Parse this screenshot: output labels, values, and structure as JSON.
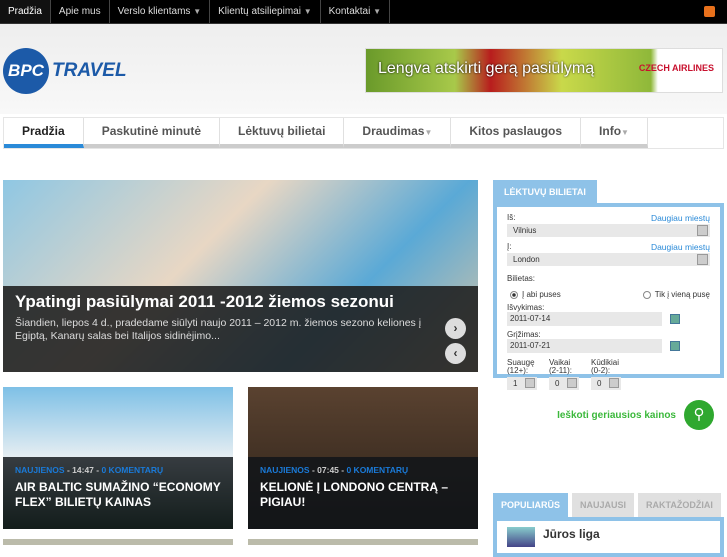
{
  "topnav": [
    {
      "label": "Pradžia",
      "active": true
    },
    {
      "label": "Apie mus"
    },
    {
      "label": "Verslo klientams",
      "dropdown": true
    },
    {
      "label": "Klientų atsiliepimai",
      "dropdown": true
    },
    {
      "label": "Kontaktai",
      "dropdown": true
    }
  ],
  "logo": {
    "circle": "BPC",
    "text": "TRAVEL"
  },
  "banner": {
    "text": "Lengva atskirti gerą pasiūlymą",
    "brand": "CZECH AIRLINES"
  },
  "mainnav": [
    {
      "label": "Pradžia",
      "active": true
    },
    {
      "label": "Paskutinė minutė"
    },
    {
      "label": "Lėktuvų bilietai"
    },
    {
      "label": "Draudimas",
      "dropdown": true
    },
    {
      "label": "Kitos paslaugos"
    },
    {
      "label": "Info",
      "dropdown": true
    }
  ],
  "slider": {
    "title": "Ypatingi pasiūlymai 2011 -2012 žiemos sezonui",
    "text": "Šiandien, liepos 4 d., pradedame siūlyti naujo 2011 – 2012 m.  žiemos sezono keliones į Egiptą, Kanarų salas bei Italijos sidinėjimo...",
    "next": "›",
    "prev": "‹"
  },
  "cards": [
    {
      "category": "NAUJIENOS",
      "time": "14:47",
      "comments": "0 KOMENTARŲ",
      "title": "AIR BALTIC SUMAŽINO “ECONOMY FLEX” BILIETŲ KAINAS"
    },
    {
      "category": "NAUJIENOS",
      "time": "07:45",
      "comments": "0 KOMENTARŲ",
      "title": "KELIONĖ Į LONDONO CENTRĄ – PIGIAU!"
    }
  ],
  "booking": {
    "tab": "LĖKTUVŲ BILIETAI",
    "from_label": "Iš:",
    "from_value": "Vilnius",
    "to_label": "Į:",
    "to_value": "London",
    "more_cities": "Daugiau miestų",
    "ticket_label": "Bilietas:",
    "round": "Į abi puses",
    "oneway": "Tik į vieną pusę",
    "depart_label": "Išvykimas:",
    "depart": "2011-07-14",
    "return_label": "Grįžimas:",
    "return": "2011-07-21",
    "adults_label": "Suaugę (12+):",
    "adults": "1",
    "children_label": "Vaikai (2-11):",
    "children": "0",
    "infants_label": "Kūdikiai (0-2):",
    "infants": "0",
    "search": "Ieškoti geriausios kainos"
  },
  "tabs2": [
    {
      "label": "POPULIARŪS",
      "active": true
    },
    {
      "label": "NAUJAUSI"
    },
    {
      "label": "RAKTAŽODŽIAI"
    }
  ],
  "popular": [
    {
      "title": "Jūros liga"
    }
  ]
}
